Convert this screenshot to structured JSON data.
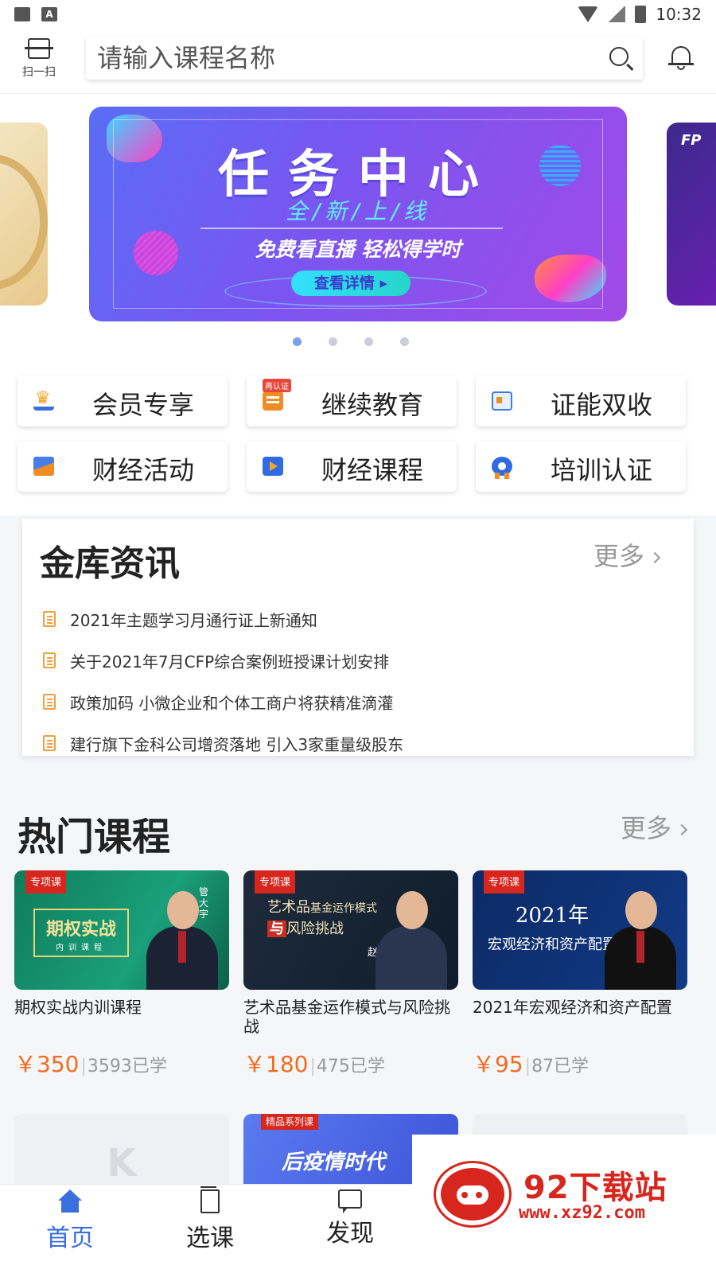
{
  "status_bar": {
    "time": "10:32",
    "left_icons": [
      "image-icon",
      "a-icon"
    ]
  },
  "header": {
    "scan_label": "扫一扫",
    "search_placeholder": "请输入课程名称"
  },
  "banner": {
    "title": "任务中心",
    "subtitle": "全/新/上/线",
    "desc": "免费看直播 轻松得学时",
    "button": "查看详情 ▸",
    "right_peek_text": "FP",
    "pager_count": 4,
    "active_index": 0
  },
  "quick_entries": [
    {
      "label": "会员专享",
      "icon": "crown-icon"
    },
    {
      "label": "继续教育",
      "icon": "list-icon",
      "badge": "再认证"
    },
    {
      "label": "证能双收",
      "icon": "certificate-icon"
    },
    {
      "label": "财经活动",
      "icon": "chart-icon"
    },
    {
      "label": "财经课程",
      "icon": "play-icon"
    },
    {
      "label": "培训认证",
      "icon": "badge-icon"
    }
  ],
  "news": {
    "title": "金库资讯",
    "more": "更多",
    "items": [
      "2021年主题学习月通行证上新通知",
      "关于2021年7月CFP综合案例班授课计划安排",
      "政策加码 小微企业和个体工商户将获精准滴灌",
      "建行旗下金科公司增资落地 引入3家重量级股东"
    ]
  },
  "hot": {
    "title": "热门课程",
    "more": "更多",
    "courses": [
      {
        "tag": "专项课",
        "cover_title": "期权实战",
        "cover_sub": "内训课程",
        "cover_name": "管大宇",
        "name": "期权实战内训课程",
        "price": "￥350",
        "students": "3593已学"
      },
      {
        "tag": "专项课",
        "cover_title_a": "艺术品",
        "cover_title_b": "基金运作模式",
        "cover_title_c": "与",
        "cover_title_d": "风险挑战",
        "cover_name": "赵力",
        "name": "艺术品基金运作模式与风险挑战",
        "price": "￥180",
        "students": "475已学"
      },
      {
        "tag": "专项课",
        "cover_title": "2021年",
        "cover_sub": "宏观经济和资产配置",
        "name": "2021年宏观经济和资产配置",
        "price": "￥95",
        "students": "87已学"
      }
    ],
    "second_row": {
      "tag": "精品系列课",
      "title": "后疫情时代"
    }
  },
  "bottom_nav": [
    {
      "label": "首页",
      "icon": "home-icon",
      "active": true
    },
    {
      "label": "选课",
      "icon": "book-icon",
      "active": false
    },
    {
      "label": "发现",
      "icon": "chat-icon",
      "active": false
    }
  ],
  "watermark": {
    "title": "92下载站",
    "url": "www.xz92.com"
  },
  "colors": {
    "accent": "#3a6fe0",
    "price": "#f26b21",
    "tag_red": "#d7261e"
  }
}
